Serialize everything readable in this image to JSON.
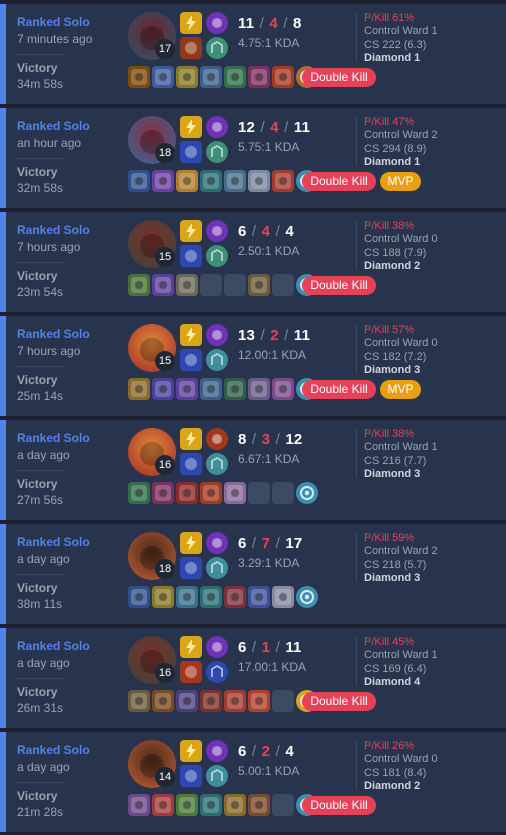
{
  "matches": [
    {
      "mode": "Ranked Solo",
      "time_ago": "7 minutes ago",
      "result": "Victory",
      "duration": "34m 58s",
      "level": "17",
      "kills": "11",
      "deaths": "4",
      "assists": "8",
      "kda_ratio": "4.75:1 KDA",
      "p_kill": "P/Kill 61%",
      "control_ward": "Control Ward 1",
      "cs": "CS 222 (6.3)",
      "rank": "Diamond 1",
      "badges": [
        "Double Kill"
      ],
      "champion_colors": [
        "#3b4a5a",
        "#6d2230"
      ],
      "spell_colors": [
        "#d9a61a",
        "#8f3a1a"
      ],
      "rune_colors": [
        "#6f33b8",
        "#3f8f79"
      ],
      "item_colors": [
        "#7c4a0c",
        "#3d5b9a",
        "#8a7a2a",
        "#3a5f8a",
        "#2f6e48",
        "#7a2f5e",
        "#a33a1f"
      ],
      "ward_color": "#b36a2a"
    },
    {
      "mode": "Ranked Solo",
      "time_ago": "an hour ago",
      "result": "Victory",
      "duration": "32m 58s",
      "level": "18",
      "kills": "12",
      "deaths": "4",
      "assists": "11",
      "kda_ratio": "5.75:1 KDA",
      "p_kill": "P/Kill 47%",
      "control_ward": "Control Ward 2",
      "cs": "CS 294 (8.9)",
      "rank": "Diamond 1",
      "badges": [
        "Double Kill",
        "MVP"
      ],
      "champion_colors": [
        "#4a5a86",
        "#8a2c3c"
      ],
      "spell_colors": [
        "#d9a61a",
        "#2f48b0"
      ],
      "rune_colors": [
        "#6f33b8",
        "#3f8f79"
      ],
      "item_colors": [
        "#2f4f8a",
        "#6a3fa0",
        "#b0802f",
        "#2a6d73",
        "#4a6d8a",
        "#7a8aa0",
        "#a33a2f"
      ],
      "ward_color": "#3a8fb0"
    },
    {
      "mode": "Ranked Solo",
      "time_ago": "7 hours ago",
      "result": "Victory",
      "duration": "23m 54s",
      "level": "15",
      "kills": "6",
      "deaths": "4",
      "assists": "4",
      "kda_ratio": "2.50:1 KDA",
      "p_kill": "P/Kill 38%",
      "control_ward": "Control Ward 0",
      "cs": "CS 188 (7.9)",
      "rank": "Diamond 2",
      "badges": [
        "Double Kill"
      ],
      "champion_colors": [
        "#4a4038",
        "#7a2f2a"
      ],
      "spell_colors": [
        "#d9a61a",
        "#2f48b0"
      ],
      "rune_colors": [
        "#6f33b8",
        "#3f8f79"
      ],
      "item_colors": [
        "#4a6f3a",
        "#5a3f9a",
        "#6a6a5a",
        "",
        "",
        "#6a5a3a",
        ""
      ],
      "ward_color": "#3a8fb0"
    },
    {
      "mode": "Ranked Solo",
      "time_ago": "7 hours ago",
      "result": "Victory",
      "duration": "25m 14s",
      "level": "15",
      "kills": "13",
      "deaths": "2",
      "assists": "11",
      "kda_ratio": "12.00:1 KDA",
      "p_kill": "P/Kill 57%",
      "control_ward": "Control Ward 0",
      "cs": "CS 182 (7.2)",
      "rank": "Diamond 3",
      "badges": [
        "Double Kill",
        "MVP"
      ],
      "champion_colors": [
        "#b0402a",
        "#e08a3a"
      ],
      "spell_colors": [
        "#d9a61a",
        "#2f48b0"
      ],
      "rune_colors": [
        "#6f33b8",
        "#3f8f9a"
      ],
      "item_colors": [
        "#8a6a2a",
        "#4a3f9a",
        "#5a3f9a",
        "#3a5f8a",
        "#2f5e48",
        "#6a5a8a",
        "#7a4a8a"
      ],
      "ward_color": "#3a8fb0"
    },
    {
      "mode": "Ranked Solo",
      "time_ago": "a day ago",
      "result": "Victory",
      "duration": "27m 56s",
      "level": "16",
      "kills": "8",
      "deaths": "3",
      "assists": "12",
      "kda_ratio": "6.67:1 KDA",
      "p_kill": "P/Kill 38%",
      "control_ward": "Control Ward 1",
      "cs": "CS 216 (7.7)",
      "rank": "Diamond 3",
      "badges": [],
      "champion_colors": [
        "#b0402a",
        "#e08a3a"
      ],
      "spell_colors": [
        "#d9a61a",
        "#2f48b0"
      ],
      "rune_colors": [
        "#a3381f",
        "#3f8f9a"
      ],
      "item_colors": [
        "#2f6e48",
        "#7a2f5e",
        "#8a2a2a",
        "#a33a1f",
        "#8a6a9a",
        "",
        ""
      ],
      "ward_color": "#3a8fb0"
    },
    {
      "mode": "Ranked Solo",
      "time_ago": "a day ago",
      "result": "Victory",
      "duration": "38m 11s",
      "level": "18",
      "kills": "6",
      "deaths": "7",
      "assists": "17",
      "kda_ratio": "3.29:1 KDA",
      "p_kill": "P/Kill 59%",
      "control_ward": "Control Ward 2",
      "cs": "CS 218 (5.7)",
      "rank": "Diamond 3",
      "badges": [],
      "champion_colors": [
        "#a3502f",
        "#4a2a1a"
      ],
      "spell_colors": [
        "#d9a61a",
        "#2f48b0"
      ],
      "rune_colors": [
        "#6f33b8",
        "#3f8f9a"
      ],
      "item_colors": [
        "#2f4f8a",
        "#8a7a2a",
        "#3a6f8a",
        "#2a6d73",
        "#7a2f3a",
        "#3a4f9a",
        "#8a8aa0"
      ],
      "ward_color": "#3a8fb0"
    },
    {
      "mode": "Ranked Solo",
      "time_ago": "a day ago",
      "result": "Victory",
      "duration": "26m 31s",
      "level": "16",
      "kills": "6",
      "deaths": "1",
      "assists": "11",
      "kda_ratio": "17.00:1 KDA",
      "p_kill": "P/Kill 45%",
      "control_ward": "Control Ward 1",
      "cs": "CS 169 (6.4)",
      "rank": "Diamond 4",
      "badges": [
        "Double Kill"
      ],
      "champion_colors": [
        "#4a4038",
        "#7a2f2a"
      ],
      "spell_colors": [
        "#d9a61a",
        "#a3381f"
      ],
      "rune_colors": [
        "#6f33b8",
        "#2f48b0"
      ],
      "item_colors": [
        "#6a5a3a",
        "#7a4a1f",
        "#4a3f7a",
        "#7a2f2a",
        "#a33a2f",
        "#b0402a",
        ""
      ],
      "ward_color": "#d9a61a"
    },
    {
      "mode": "Ranked Solo",
      "time_ago": "a day ago",
      "result": "Victory",
      "duration": "21m 28s",
      "level": "14",
      "kills": "6",
      "deaths": "2",
      "assists": "4",
      "kda_ratio": "5.00:1 KDA",
      "p_kill": "P/Kill 26%",
      "control_ward": "Control Ward 0",
      "cs": "CS 181 (8.4)",
      "rank": "Diamond 2",
      "badges": [
        "Double Kill"
      ],
      "champion_colors": [
        "#a3502f",
        "#4a2a1a"
      ],
      "spell_colors": [
        "#d9a61a",
        "#2f48b0"
      ],
      "rune_colors": [
        "#6f33b8",
        "#3f8f9a"
      ],
      "item_colors": [
        "#6a4a8a",
        "#a33a3a",
        "#4a7a3a",
        "#2a6d73",
        "#8a6a2a",
        "#7a4a2a",
        ""
      ],
      "ward_color": "#3a8fb0"
    }
  ]
}
